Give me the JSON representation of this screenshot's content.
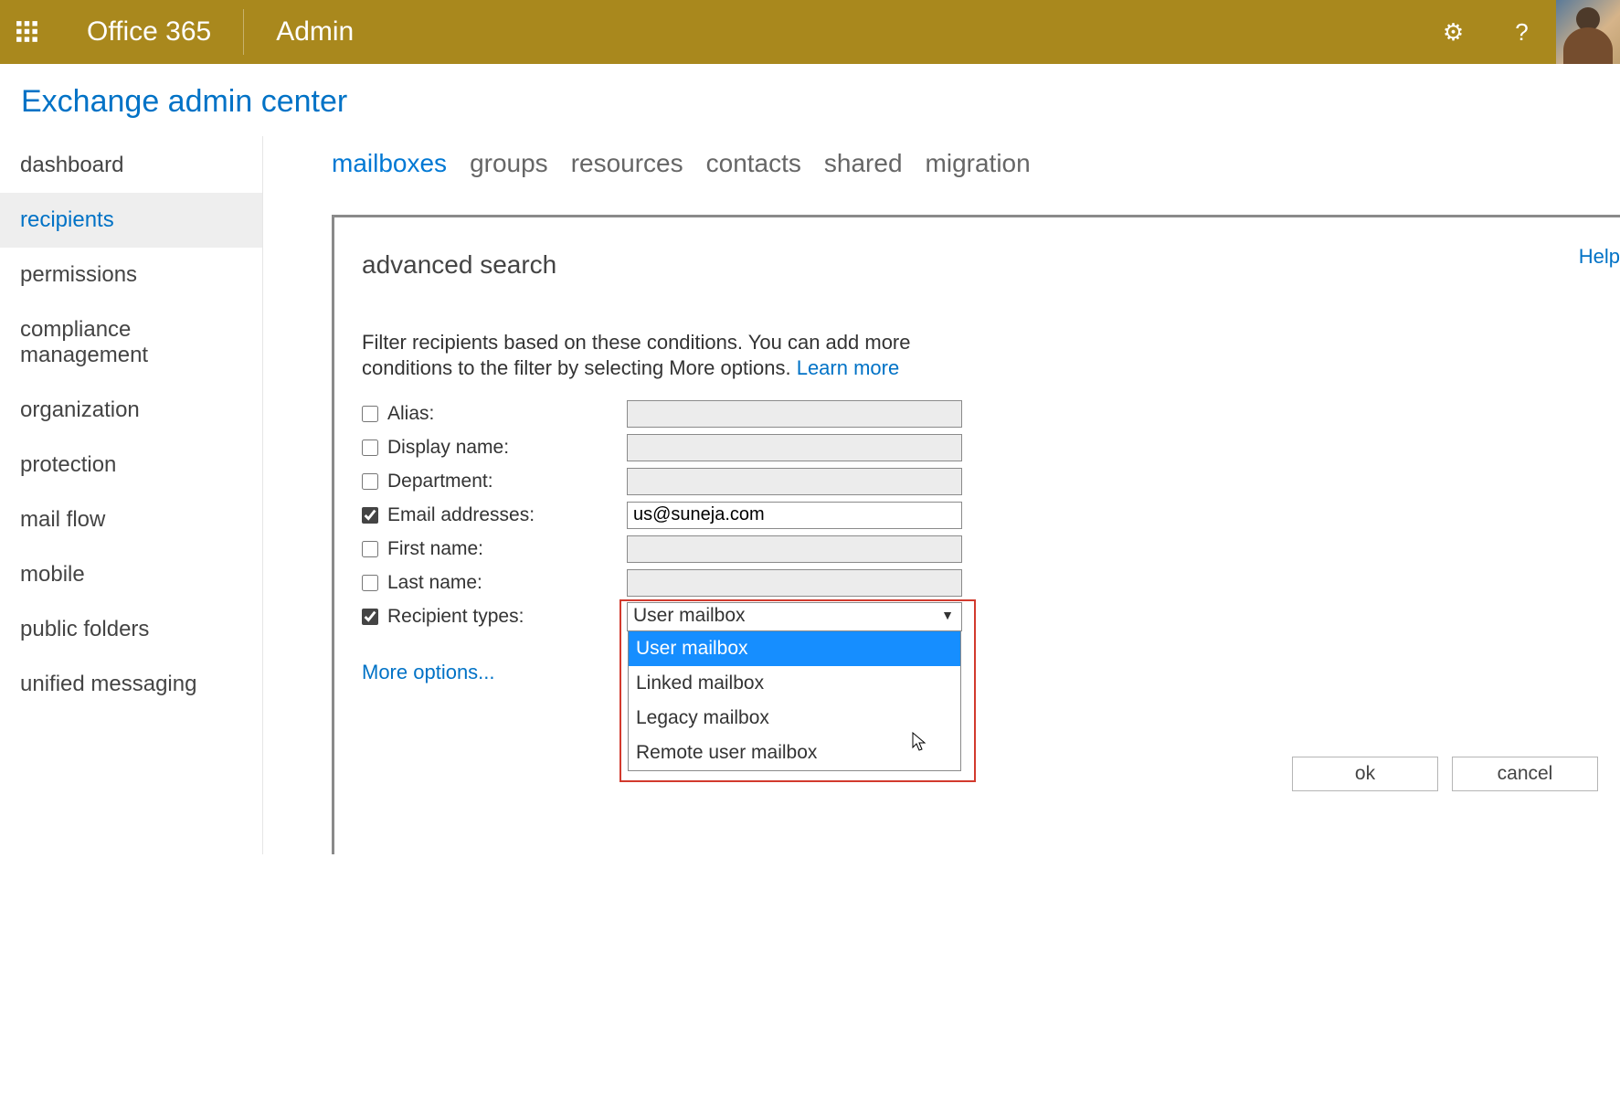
{
  "topbar": {
    "brand": "Office 365",
    "app": "Admin",
    "settings_glyph": "⚙",
    "help_glyph": "?"
  },
  "page_heading": "Exchange admin center",
  "leftnav": {
    "items": [
      {
        "label": "dashboard",
        "active": false
      },
      {
        "label": "recipients",
        "active": true
      },
      {
        "label": "permissions",
        "active": false
      },
      {
        "label": "compliance management",
        "active": false
      },
      {
        "label": "organization",
        "active": false
      },
      {
        "label": "protection",
        "active": false
      },
      {
        "label": "mail flow",
        "active": false
      },
      {
        "label": "mobile",
        "active": false
      },
      {
        "label": "public folders",
        "active": false
      },
      {
        "label": "unified messaging",
        "active": false
      }
    ]
  },
  "tabs": {
    "items": [
      {
        "label": "mailboxes",
        "active": true
      },
      {
        "label": "groups",
        "active": false
      },
      {
        "label": "resources",
        "active": false
      },
      {
        "label": "contacts",
        "active": false
      },
      {
        "label": "shared",
        "active": false
      },
      {
        "label": "migration",
        "active": false
      }
    ]
  },
  "panel": {
    "title": "advanced search",
    "help_label": "Help",
    "description_prefix": "Filter recipients based on these conditions. You can add more conditions to the filter by selecting More options. ",
    "learn_more": "Learn more",
    "more_options": "More options...",
    "rows": [
      {
        "key": "alias",
        "label": "Alias:",
        "checked": false,
        "value": ""
      },
      {
        "key": "display",
        "label": "Display name:",
        "checked": false,
        "value": ""
      },
      {
        "key": "department",
        "label": "Department:",
        "checked": false,
        "value": ""
      },
      {
        "key": "email",
        "label": "Email addresses:",
        "checked": true,
        "value": "us@suneja.com"
      },
      {
        "key": "first",
        "label": "First name:",
        "checked": false,
        "value": ""
      },
      {
        "key": "last",
        "label": "Last name:",
        "checked": false,
        "value": ""
      },
      {
        "key": "rtype",
        "label": "Recipient types:",
        "checked": true,
        "value": "User mailbox",
        "is_select": true
      }
    ],
    "select_options": [
      {
        "label": "User mailbox",
        "selected": true
      },
      {
        "label": "Linked mailbox",
        "selected": false
      },
      {
        "label": "Legacy mailbox",
        "selected": false
      },
      {
        "label": "Remote user mailbox",
        "selected": false
      }
    ],
    "buttons": {
      "ok": "ok",
      "cancel": "cancel"
    }
  }
}
